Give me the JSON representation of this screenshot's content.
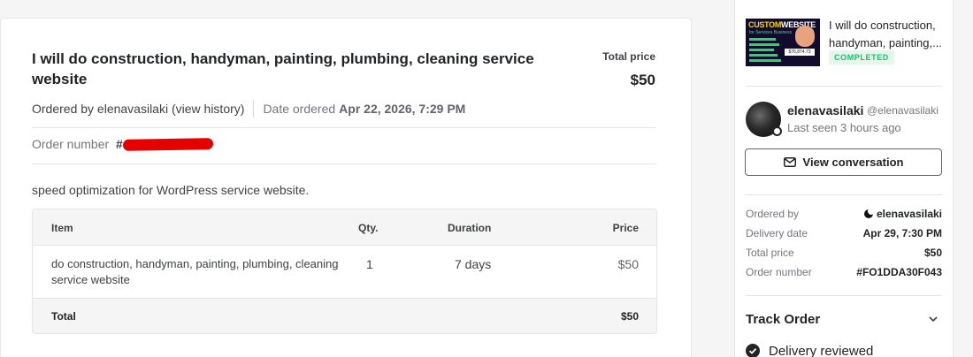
{
  "order": {
    "title": "I will do construction, handyman, painting, plumbing, cleaning service website",
    "total_price_label": "Total price",
    "total_price": "$50",
    "ordered_by_text": "Ordered by elenavasilaki (view history)",
    "date_ordered_label": "Date ordered",
    "date_ordered": "Apr 22, 2026, 7:29 PM",
    "order_number_label": "Order number",
    "order_number_hash": "#",
    "order_number_redacted_text": "FO1DDA30F043",
    "description": "speed optimization for WordPress service website."
  },
  "table": {
    "headers": {
      "item": "Item",
      "qty": "Qty.",
      "duration": "Duration",
      "price": "Price"
    },
    "row": {
      "item_line1": "do construction, handyman, painting, plumbing, cleaning",
      "item_line2": "service website",
      "qty": "1",
      "duration": "7 days",
      "price": "$50"
    },
    "total_label": "Total",
    "total_value": "$50"
  },
  "sidebar": {
    "gig_title": "I will do construction, handyman, painting,...",
    "status": "COMPLETED",
    "thumb": {
      "headline_a": "CUSTOM",
      "headline_b": "WEBSITE",
      "sub": "for Services Business",
      "price": "$76,874.73"
    },
    "seller": {
      "username": "elenavasilaki",
      "handle": "@elenavasilaki",
      "last_seen": "Last seen 3 hours ago"
    },
    "view_conversation": "View conversation",
    "details": {
      "ordered_by_label": "Ordered by",
      "ordered_by_value": "elenavasilaki",
      "delivery_date_label": "Delivery date",
      "delivery_date_value": "Apr 29, 7:30 PM",
      "total_price_label": "Total price",
      "total_price_value": "$50",
      "order_number_label": "Order number",
      "order_number_value": "#FO1DDA30F043"
    },
    "track_order": "Track Order",
    "delivery_reviewed": "Delivery reviewed"
  },
  "colors": {
    "completed_text": "#1dbf73",
    "completed_bg": "#e5f6ea",
    "redaction": "#e60000"
  }
}
